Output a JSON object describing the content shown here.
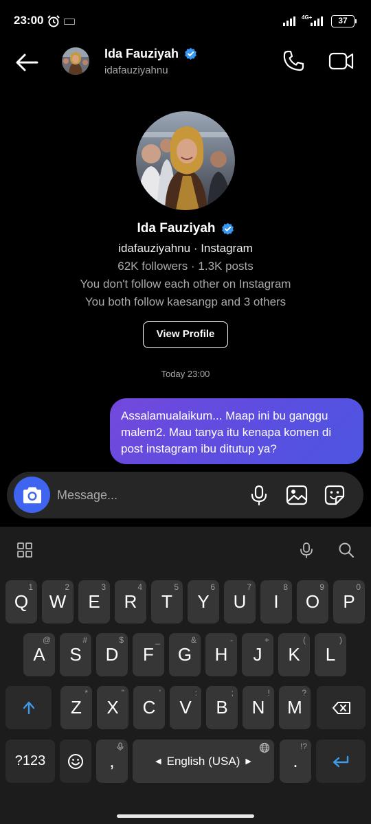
{
  "status_bar": {
    "time": "23:00",
    "network": "4G+",
    "battery": "37",
    "icons": [
      "alarm-icon",
      "keyboard-icon",
      "signal-icon",
      "battery-icon"
    ]
  },
  "header": {
    "name": "Ida Fauziyah",
    "username": "idafauziyahnu",
    "verified": true,
    "icons": [
      "back-arrow-icon",
      "phone-icon",
      "video-icon"
    ]
  },
  "profile": {
    "name": "Ida Fauziyah",
    "username_line": "idafauziyahnu · Instagram",
    "stats_line": "62K followers · 1.3K posts",
    "follow_line_1": "You don't follow each other on Instagram",
    "follow_line_2": "You both follow kaesangp and 3 others",
    "view_profile_label": "View Profile"
  },
  "chat": {
    "timestamp": "Today 23:00",
    "messages": [
      {
        "sender": "me",
        "text": "Assalamualaikum... Maap ini bu ganggu malem2. Mau tanya itu kenapa komen di post instagram ibu ditutup ya?"
      }
    ]
  },
  "composer": {
    "placeholder": "Message...",
    "icons": [
      "camera-icon",
      "microphone-icon",
      "gallery-icon",
      "sticker-icon"
    ]
  },
  "keyboard": {
    "toolbar_icons": [
      "apps-grid-icon",
      "microphone-icon",
      "search-icon"
    ],
    "row1": [
      {
        "key": "Q",
        "hint": "1"
      },
      {
        "key": "W",
        "hint": "2"
      },
      {
        "key": "E",
        "hint": "3"
      },
      {
        "key": "R",
        "hint": "4"
      },
      {
        "key": "T",
        "hint": "5"
      },
      {
        "key": "Y",
        "hint": "6"
      },
      {
        "key": "U",
        "hint": "7"
      },
      {
        "key": "I",
        "hint": "8"
      },
      {
        "key": "O",
        "hint": "9"
      },
      {
        "key": "P",
        "hint": "0"
      }
    ],
    "row2": [
      {
        "key": "A",
        "hint": "@"
      },
      {
        "key": "S",
        "hint": "#"
      },
      {
        "key": "D",
        "hint": "$"
      },
      {
        "key": "F",
        "hint": "_"
      },
      {
        "key": "G",
        "hint": "&"
      },
      {
        "key": "H",
        "hint": "-"
      },
      {
        "key": "J",
        "hint": "+"
      },
      {
        "key": "K",
        "hint": "("
      },
      {
        "key": "L",
        "hint": ")"
      }
    ],
    "row3": [
      {
        "key": "Z",
        "hint": "*"
      },
      {
        "key": "X",
        "hint": "\""
      },
      {
        "key": "C",
        "hint": "'"
      },
      {
        "key": "V",
        "hint": ":"
      },
      {
        "key": "B",
        "hint": ";"
      },
      {
        "key": "N",
        "hint": "!"
      },
      {
        "key": "M",
        "hint": "?"
      }
    ],
    "symbols_label": "?123",
    "comma_label": ",",
    "space_label": "English (USA)",
    "period_label": ".",
    "period_hint": "!?",
    "accent": "#3d9be9"
  },
  "colors": {
    "bubble_start": "#7448dc",
    "bubble_end": "#4d56e0",
    "camera_button": "#3f65f0",
    "verified": "#3897f0"
  }
}
